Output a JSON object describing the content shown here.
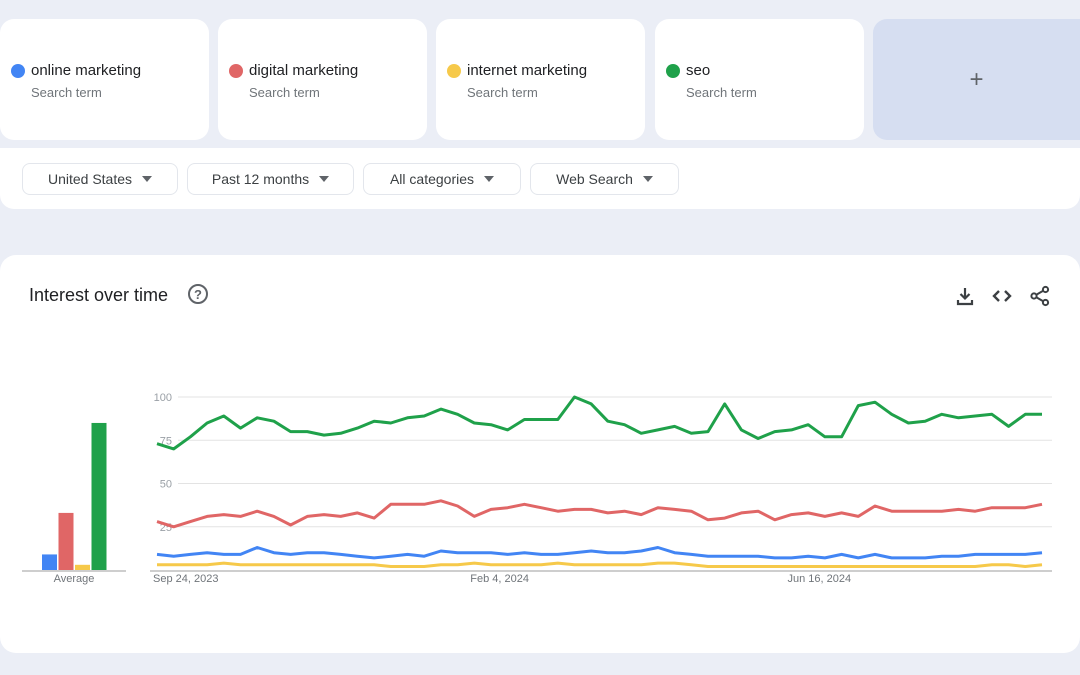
{
  "search_terms": [
    {
      "label": "online marketing",
      "sublabel": "Search term",
      "color": "#4285f4"
    },
    {
      "label": "digital marketing",
      "sublabel": "Search term",
      "color": "#e06666"
    },
    {
      "label": "internet marketing",
      "sublabel": "Search term",
      "color": "#f6c94a"
    },
    {
      "label": "seo",
      "sublabel": "Search term",
      "color": "#1fa14a"
    }
  ],
  "add_term_label": "+",
  "filters": [
    {
      "label": "United States"
    },
    {
      "label": "Past 12 months"
    },
    {
      "label": "All categories"
    },
    {
      "label": "Web Search"
    }
  ],
  "panel": {
    "title": "Interest over time",
    "help_label": "?",
    "icons": [
      "download-icon",
      "embed-code-icon",
      "share-icon"
    ]
  },
  "chart_data": {
    "type": "line",
    "title": "Interest over time",
    "xlabel": "",
    "ylabel": "",
    "ylim": [
      0,
      100
    ],
    "yticks": [
      25,
      50,
      75,
      100
    ],
    "grid": true,
    "x_tick_labels": [
      {
        "index": 0,
        "label": "Sep 24, 2023"
      },
      {
        "index": 19,
        "label": "Feb 4, 2024"
      },
      {
        "index": 38,
        "label": "Jun 16, 2024"
      }
    ],
    "series": [
      {
        "name": "online marketing",
        "color": "#4285f4",
        "values": [
          9,
          8,
          9,
          10,
          9,
          9,
          13,
          10,
          9,
          10,
          10,
          9,
          8,
          7,
          8,
          9,
          8,
          11,
          10,
          10,
          10,
          9,
          10,
          9,
          9,
          10,
          11,
          10,
          10,
          11,
          13,
          10,
          9,
          8,
          8,
          8,
          8,
          7,
          7,
          8,
          7,
          9,
          7,
          9,
          7,
          7,
          7,
          8,
          8,
          9,
          9,
          9,
          9,
          10
        ]
      },
      {
        "name": "digital marketing",
        "color": "#e06666",
        "values": [
          28,
          25,
          28,
          31,
          32,
          31,
          34,
          31,
          26,
          31,
          32,
          31,
          33,
          30,
          38,
          38,
          38,
          40,
          37,
          31,
          35,
          36,
          38,
          36,
          34,
          35,
          35,
          33,
          34,
          32,
          36,
          35,
          34,
          29,
          30,
          33,
          34,
          29,
          32,
          33,
          31,
          33,
          31,
          37,
          34,
          34,
          34,
          34,
          35,
          34,
          36,
          36,
          36,
          38
        ]
      },
      {
        "name": "internet marketing",
        "color": "#f6c94a",
        "values": [
          3,
          3,
          3,
          3,
          4,
          3,
          3,
          3,
          3,
          3,
          3,
          3,
          3,
          3,
          2,
          2,
          2,
          3,
          3,
          4,
          3,
          3,
          3,
          3,
          4,
          3,
          3,
          3,
          3,
          3,
          4,
          4,
          3,
          2,
          2,
          2,
          2,
          2,
          2,
          2,
          2,
          2,
          2,
          2,
          2,
          2,
          2,
          2,
          2,
          2,
          3,
          3,
          2,
          3
        ]
      },
      {
        "name": "seo",
        "color": "#1fa14a",
        "values": [
          73,
          70,
          77,
          85,
          89,
          82,
          88,
          86,
          80,
          80,
          78,
          79,
          82,
          86,
          85,
          88,
          89,
          93,
          90,
          85,
          84,
          81,
          87,
          87,
          87,
          100,
          96,
          86,
          84,
          79,
          81,
          83,
          79,
          80,
          96,
          81,
          76,
          80,
          81,
          84,
          77,
          77,
          95,
          97,
          90,
          85,
          86,
          90,
          88,
          89,
          90,
          83,
          90,
          90
        ]
      }
    ],
    "average_bar": {
      "label": "Average",
      "values": [
        {
          "name": "online marketing",
          "value": 9
        },
        {
          "name": "digital marketing",
          "value": 33
        },
        {
          "name": "internet marketing",
          "value": 3
        },
        {
          "name": "seo",
          "value": 85
        }
      ]
    }
  }
}
